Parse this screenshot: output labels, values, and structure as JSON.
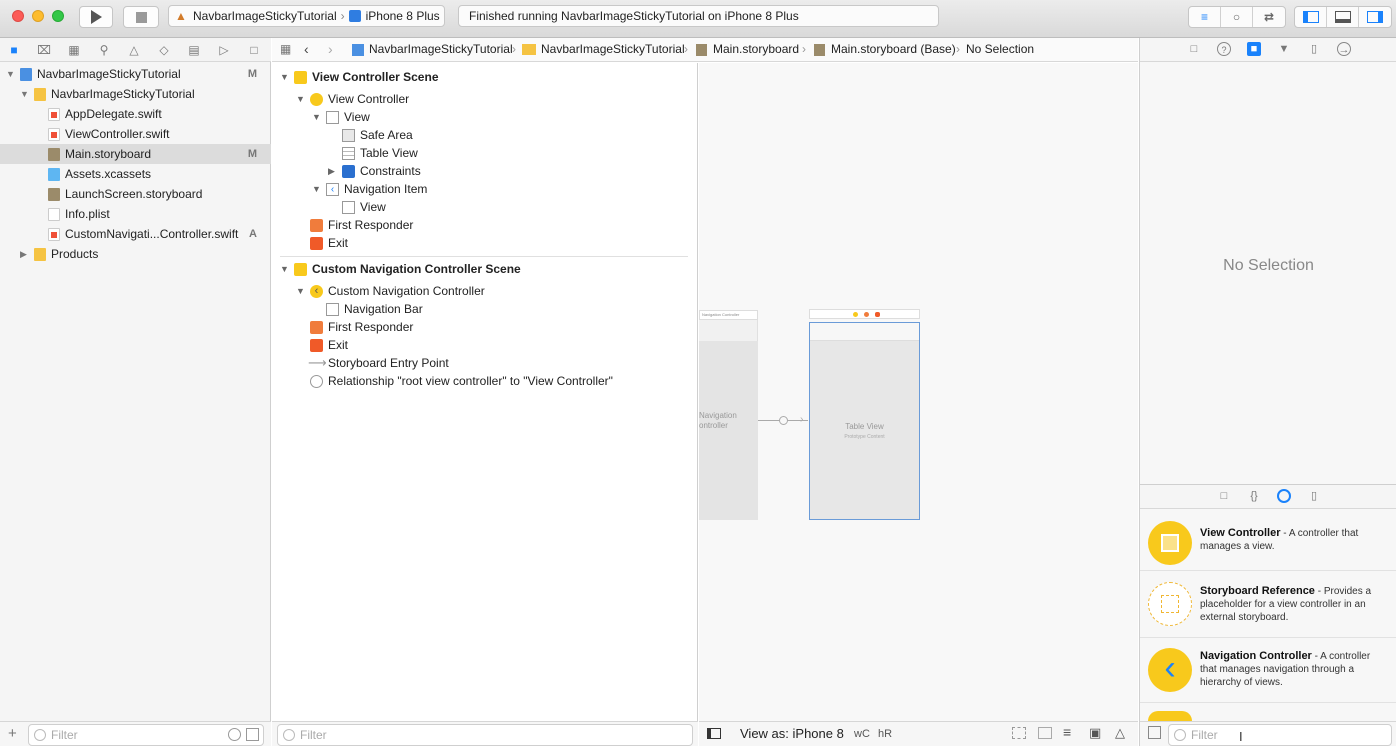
{
  "toolbar": {
    "scheme_project": "NavbarImageStickyTutorial",
    "scheme_device": "iPhone 8 Plus",
    "status_text": "Finished running NavbarImageStickyTutorial on iPhone 8 Plus"
  },
  "navigator": {
    "items": [
      {
        "label": "NavbarImageStickyTutorial",
        "badge": "M"
      },
      {
        "label": "NavbarImageStickyTutorial",
        "badge": ""
      },
      {
        "label": "AppDelegate.swift",
        "badge": ""
      },
      {
        "label": "ViewController.swift",
        "badge": ""
      },
      {
        "label": "Main.storyboard",
        "badge": "M"
      },
      {
        "label": "Assets.xcassets",
        "badge": ""
      },
      {
        "label": "LaunchScreen.storyboard",
        "badge": ""
      },
      {
        "label": "Info.plist",
        "badge": ""
      },
      {
        "label": "CustomNavigati...Controller.swift",
        "badge": "A"
      },
      {
        "label": "Products",
        "badge": ""
      }
    ],
    "filter_placeholder": "Filter"
  },
  "jumpbar": {
    "crumbs": [
      "NavbarImageStickyTutorial",
      "NavbarImageStickyTutorial",
      "Main.storyboard",
      "Main.storyboard (Base)",
      "No Selection"
    ]
  },
  "outline": {
    "rows": [
      "View Controller Scene",
      "View Controller",
      "View",
      "Safe Area",
      "Table View",
      "Constraints",
      "Navigation Item",
      "View",
      "First Responder",
      "Exit",
      "Custom Navigation Controller Scene",
      "Custom Navigation Controller",
      "Navigation Bar",
      "First Responder",
      "Exit",
      "Storyboard Entry Point",
      "Relationship \"root view controller\" to \"View Controller\""
    ],
    "filter_placeholder": "Filter"
  },
  "canvas": {
    "nav_controller_title": "Navigation Controller",
    "nav_controller_label_1": "Navigation",
    "nav_controller_label_2": "ontroller",
    "table_view_label": "Table View",
    "table_view_sublabel": "Prototype Content",
    "view_as": "View as: iPhone 8",
    "size_w": "wC",
    "size_h": "hR"
  },
  "inspector": {
    "empty_text": "No Selection",
    "library": [
      {
        "title": "View Controller",
        "desc": " - A controller that manages a view."
      },
      {
        "title": "Storyboard Reference",
        "desc": " - Provides a placeholder for a view controller in an external storyboard."
      },
      {
        "title": "Navigation Controller",
        "desc": " - A controller that manages navigation through a hierarchy of views."
      }
    ],
    "filter_placeholder": "Filter"
  },
  "colors": {
    "accent": "#1a82fb",
    "folder": "#f5c342",
    "swift": "#f05138",
    "scene_yellow": "#f8c91c"
  }
}
